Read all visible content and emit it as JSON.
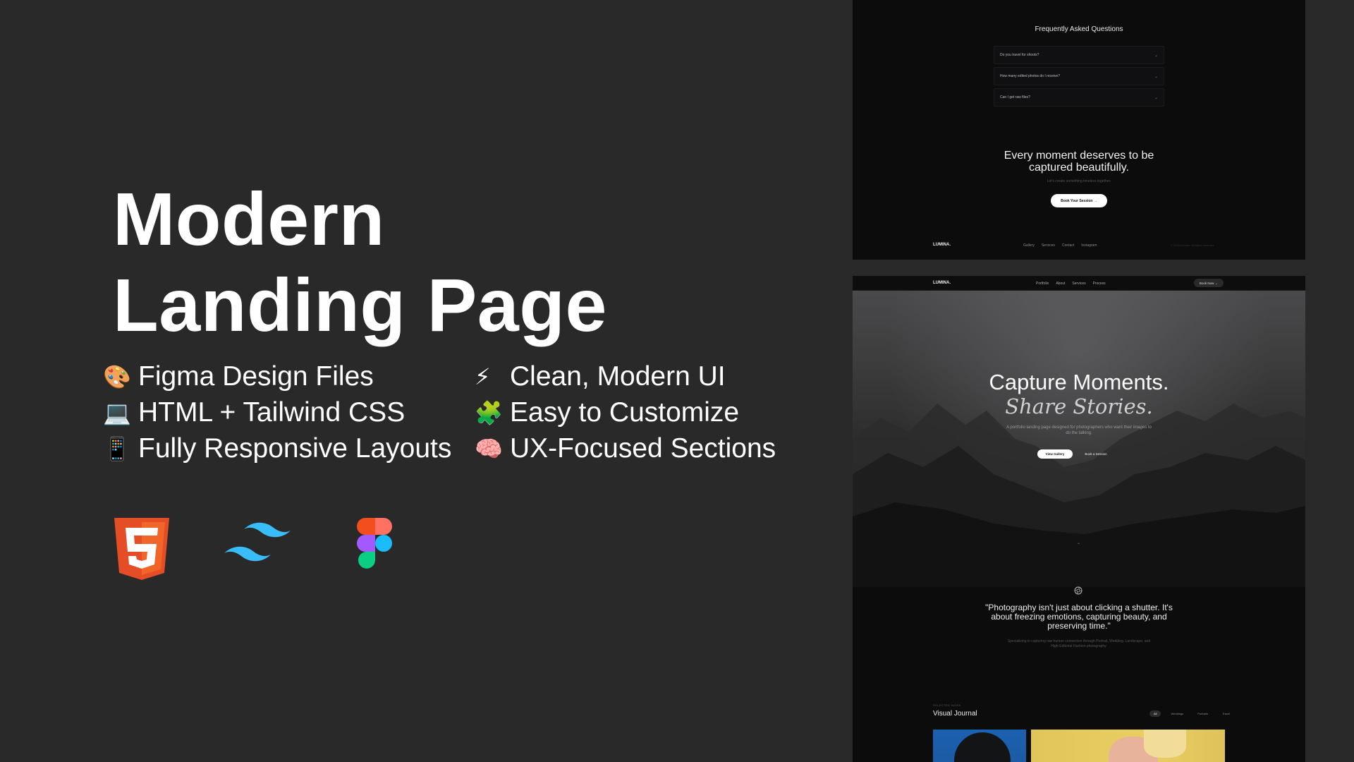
{
  "headline": {
    "line1": "Modern",
    "line2": "Landing Page"
  },
  "features": [
    {
      "emoji": "🎨",
      "text": "Figma Design Files"
    },
    {
      "emoji": "⚡",
      "text": "Clean, Modern UI"
    },
    {
      "emoji": "💻",
      "text": "HTML + Tailwind CSS"
    },
    {
      "emoji": "🧩",
      "text": "Easy to Customize"
    },
    {
      "emoji": "📱",
      "text": "Fully Responsive Layouts"
    },
    {
      "emoji": "🧠",
      "text": "UX-Focused Sections"
    }
  ],
  "logos": [
    "html5-logo",
    "tailwind-logo",
    "figma-logo"
  ],
  "colors": {
    "background": "#292929",
    "html5": "#e44d26",
    "tailwind": "#38bdf8",
    "figma_red": "#f24e1e",
    "figma_orange": "#ff7262",
    "figma_purple": "#a259ff",
    "figma_blue": "#1abcfe",
    "figma_green": "#0acf83"
  },
  "preview_top": {
    "faq_title": "Frequently Asked Questions",
    "faq_items": [
      "Do you travel for shoots?",
      "How many edited photos do I receive?",
      "Can I get raw files?"
    ],
    "cta_heading_line1": "Every moment deserves to be",
    "cta_heading_line2": "captured beautifully.",
    "cta_sub": "Let's create something timeless together.",
    "cta_button": "Book Your Session →",
    "footer_brand": "LUMINA.",
    "footer_links": [
      "Gallery",
      "Services",
      "Contact",
      "Instagram"
    ],
    "footer_copy": "© 2025 Lumina. All rights reserved."
  },
  "preview_bottom": {
    "nav_brand": "LUMINA.",
    "nav_links": [
      "Portfolio",
      "About",
      "Services",
      "Process"
    ],
    "nav_button": "Book Now →",
    "hero_title": "Capture Moments.",
    "hero_subtitle": "Share Stories.",
    "hero_desc": "A portfolio landing page designed for photographers who want their images to do the talking.",
    "hero_btn_primary": "View Gallery",
    "hero_btn_secondary": "Book a Session",
    "scroll_hint": "⌄",
    "quote": "\"Photography isn't just about clicking a shutter. It's about freezing emotions, capturing beauty, and preserving time.\"",
    "quote_sub": "Specializing in capturing raw human connection through Portrait, Wedding, Landscape, and High-Editorial Fashion photography.",
    "work_eyebrow": "SELECTED WORK",
    "work_title": "Visual Journal",
    "filters": [
      "All",
      "Weddings",
      "Portraits",
      "Travel"
    ]
  }
}
